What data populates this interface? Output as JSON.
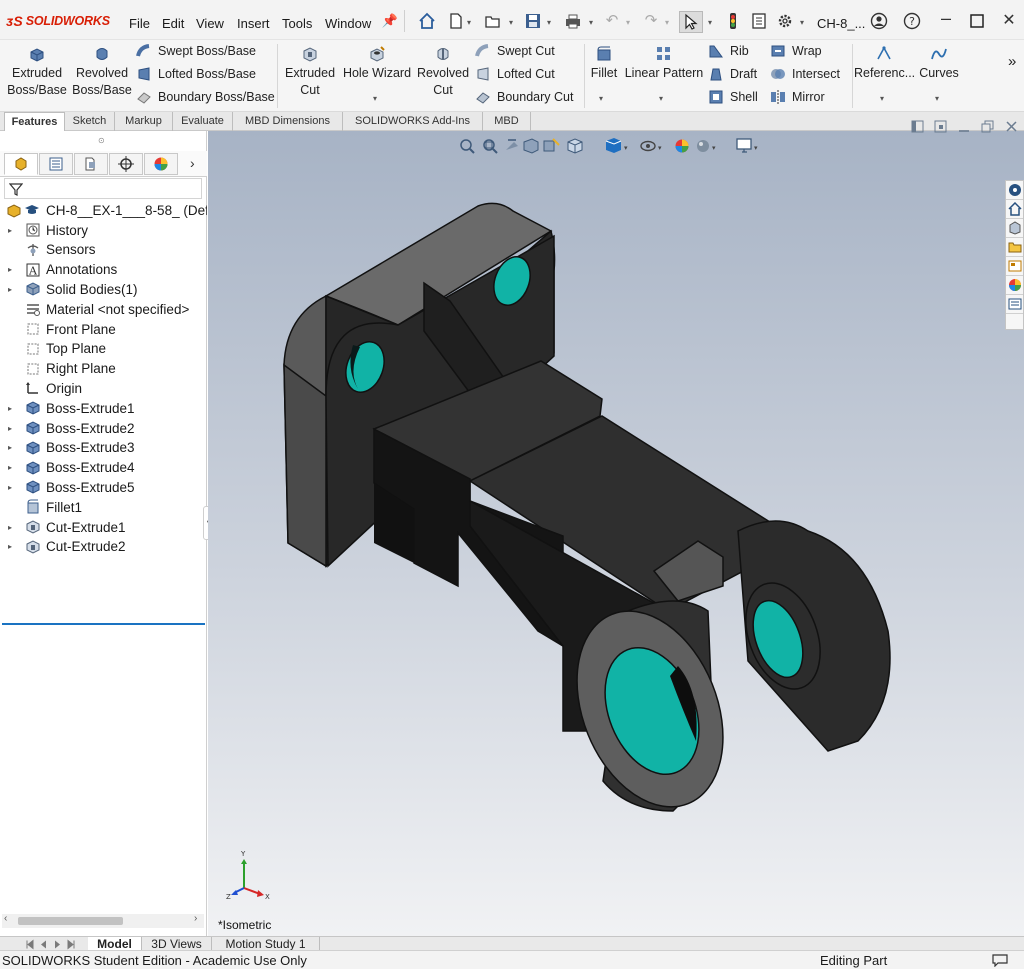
{
  "app": {
    "logo_text": "SOLIDWORKS",
    "doc_title_short": "CH-8_..."
  },
  "menu": [
    "File",
    "Edit",
    "View",
    "Insert",
    "Tools",
    "Window"
  ],
  "ribbon": {
    "extruded_boss": "Extruded\nBoss/Base",
    "revolved_boss": "Revolved\nBoss/Base",
    "swept_boss": "Swept Boss/Base",
    "lofted_boss": "Lofted Boss/Base",
    "boundary_boss": "Boundary Boss/Base",
    "extruded_cut": "Extruded\nCut",
    "hole_wizard": "Hole Wizard",
    "revolved_cut": "Revolved\nCut",
    "swept_cut": "Swept Cut",
    "lofted_cut": "Lofted Cut",
    "boundary_cut": "Boundary Cut",
    "fillet": "Fillet",
    "linear_pattern": "Linear Pattern",
    "rib": "Rib",
    "draft": "Draft",
    "shell": "Shell",
    "wrap": "Wrap",
    "intersect": "Intersect",
    "mirror": "Mirror",
    "reference": "Referenc...",
    "curves": "Curves",
    "more": "»"
  },
  "tabs": [
    "Features",
    "Sketch",
    "Markup",
    "Evaluate",
    "MBD Dimensions",
    "SOLIDWORKS Add-Ins",
    "MBD"
  ],
  "tree": {
    "root": "CH-8__EX-1___8-58_ (Defa",
    "items": [
      {
        "label": "History",
        "expandable": true,
        "icon": "history-icon"
      },
      {
        "label": "Sensors",
        "expandable": false,
        "icon": "sensor-icon"
      },
      {
        "label": "Annotations",
        "expandable": true,
        "icon": "annotation-icon"
      },
      {
        "label": "Solid Bodies(1)",
        "expandable": true,
        "icon": "solid-bodies-icon"
      },
      {
        "label": "Material <not specified>",
        "expandable": false,
        "icon": "material-icon"
      },
      {
        "label": "Front Plane",
        "expandable": false,
        "icon": "plane-icon"
      },
      {
        "label": "Top Plane",
        "expandable": false,
        "icon": "plane-icon"
      },
      {
        "label": "Right Plane",
        "expandable": false,
        "icon": "plane-icon"
      },
      {
        "label": "Origin",
        "expandable": false,
        "icon": "origin-icon"
      },
      {
        "label": "Boss-Extrude1",
        "expandable": true,
        "icon": "boss-extrude-icon"
      },
      {
        "label": "Boss-Extrude2",
        "expandable": true,
        "icon": "boss-extrude-icon"
      },
      {
        "label": "Boss-Extrude3",
        "expandable": true,
        "icon": "boss-extrude-icon"
      },
      {
        "label": "Boss-Extrude4",
        "expandable": true,
        "icon": "boss-extrude-icon"
      },
      {
        "label": "Boss-Extrude5",
        "expandable": true,
        "icon": "boss-extrude-icon"
      },
      {
        "label": "Fillet1",
        "expandable": false,
        "icon": "fillet-icon"
      },
      {
        "label": "Cut-Extrude1",
        "expandable": true,
        "icon": "cut-extrude-icon"
      },
      {
        "label": "Cut-Extrude2",
        "expandable": true,
        "icon": "cut-extrude-icon"
      }
    ]
  },
  "viewport": {
    "view_name": "*Isometric",
    "triad_y": "Y",
    "triad_x": "X",
    "triad_z": "Z"
  },
  "bottom_tabs": [
    "Model",
    "3D Views",
    "Motion Study 1"
  ],
  "status": {
    "left": "SOLIDWORKS Student Edition - Academic Use Only",
    "right": "Editing Part"
  },
  "colors": {
    "accent_red": "#d81e05",
    "model_body": "#2e2e2e",
    "hole_teal": "#1aa59b",
    "tree_selection": "#1a73c2"
  }
}
